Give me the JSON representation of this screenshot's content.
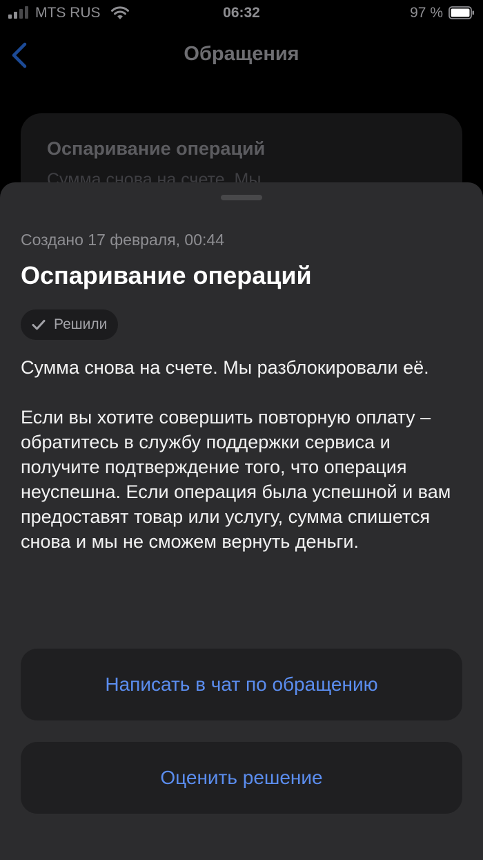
{
  "status_bar": {
    "carrier": "MTS RUS",
    "time": "06:32",
    "battery_percent": "97 %",
    "icons": [
      "signal-icon",
      "wifi-icon",
      "battery-icon"
    ]
  },
  "nav": {
    "back_icon": "chevron-left-icon",
    "title": "Обращения"
  },
  "background_card": {
    "title": "Оспаривание операций",
    "preview": "Сумма снова на счете. Мы"
  },
  "sheet": {
    "created": "Создано 17 февраля, 00:44",
    "title": "Оспаривание операций",
    "badge": {
      "icon": "checkmark-icon",
      "label": "Решили"
    },
    "paragraph1": "Сумма снова на счете. Мы разблокировали её.",
    "paragraph2": "Если вы хотите совершить повторную оплату – обратитесь в службу поддержки сервиса и получите подтверждение того, что операция неуспешна. Если операция была успешной и вам предоставят товар или услугу, сумма спишется снова и мы не сможем вернуть деньги.",
    "chat_button": "Написать в чат по обращению",
    "rate_button": "Оценить решение"
  },
  "colors": {
    "accent": "#5b8def",
    "sheet_background": "#2c2c2e",
    "button_background": "#1f1f21"
  }
}
